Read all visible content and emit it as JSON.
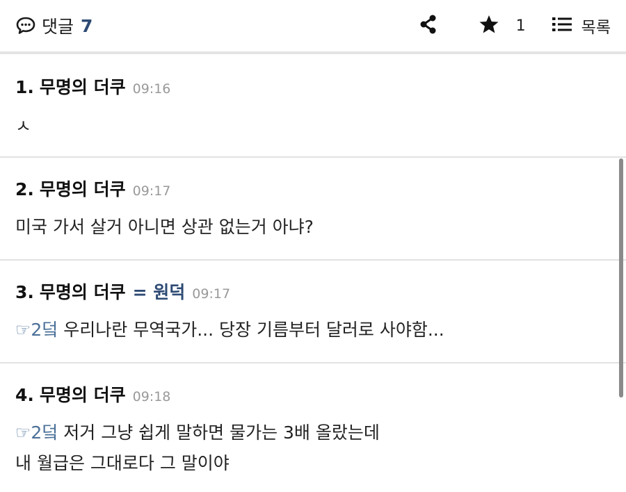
{
  "header": {
    "comments_label": "댓글",
    "comments_count": "7",
    "star_count": "1",
    "list_label": "목록"
  },
  "icons": {
    "comment": "speech-bubble-icon",
    "share": "share-icon",
    "star": "star-icon",
    "list": "list-icon"
  },
  "comments": [
    {
      "num": "1.",
      "author": "무명의 더쿠",
      "time": "09:16",
      "body": "ㅅ"
    },
    {
      "num": "2.",
      "author": "무명의 더쿠",
      "time": "09:17",
      "body": "미국 가서 살거 아니면 상관 없는거 아냐?"
    },
    {
      "num": "3.",
      "author": "무명의 더쿠",
      "relation": "= 원덕",
      "time": "09:17",
      "reply_ref": "☞2덬",
      "body": " 우리나란 무역국가... 당장 기름부터 달러로 사야함..."
    },
    {
      "num": "4.",
      "author": "무명의 더쿠",
      "time": "09:18",
      "reply_ref": "☞2덬",
      "body_line1": " 저거 그냥 쉽게 말하면 물가는 3배 올랐는데",
      "body_line2": "내 월급은 그대로다 그 말이야"
    }
  ],
  "colors": {
    "accent": "#2d4a73",
    "reply_ref": "#4a6f97",
    "time": "#999999",
    "divider": "#e2e2e2"
  }
}
